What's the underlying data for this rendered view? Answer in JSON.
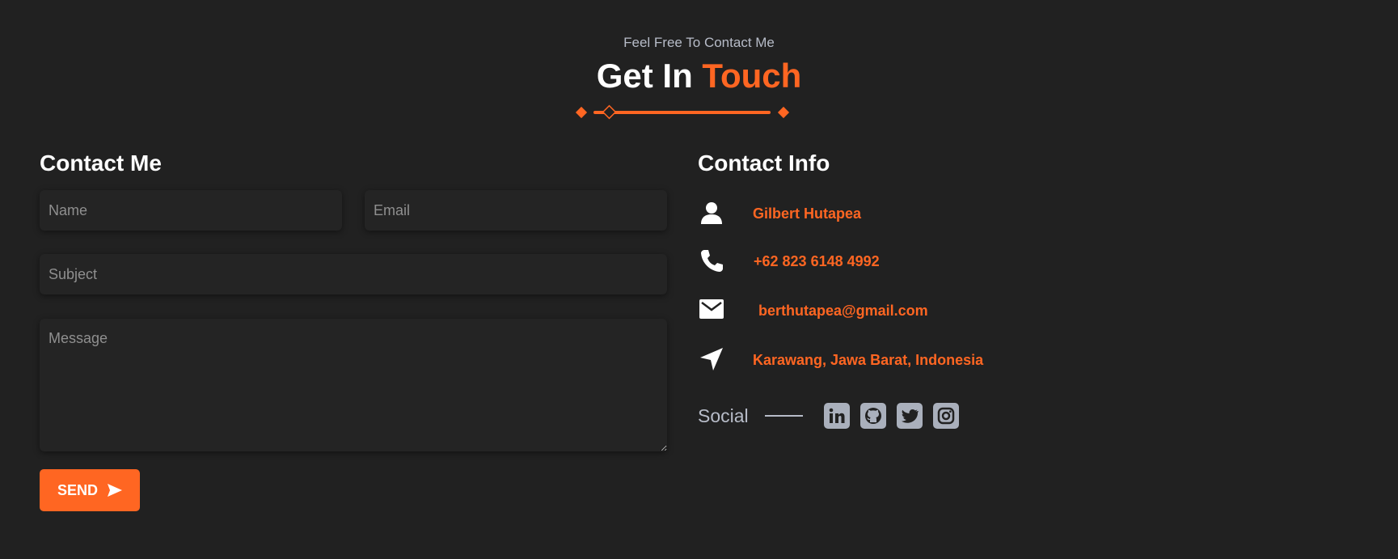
{
  "header": {
    "subtitle": "Feel Free To Contact Me",
    "title_main": "Get In",
    "title_accent": "Touch"
  },
  "form": {
    "heading": "Contact Me",
    "name_placeholder": "Name",
    "email_placeholder": "Email",
    "subject_placeholder": "Subject",
    "message_placeholder": "Message",
    "send_label": "SEND"
  },
  "info": {
    "heading": "Contact Info",
    "name": "Gilbert Hutapea",
    "phone": "+62 823 6148 4992",
    "email": "berthutapea@gmail.com",
    "location": "Karawang, Jawa Barat, Indonesia"
  },
  "social": {
    "label": "Social",
    "icons": [
      "linkedin-icon",
      "github-icon",
      "twitter-icon",
      "instagram-icon"
    ]
  },
  "colors": {
    "background": "#212121",
    "accent": "#ff6622",
    "muted": "#b7bcc8"
  }
}
